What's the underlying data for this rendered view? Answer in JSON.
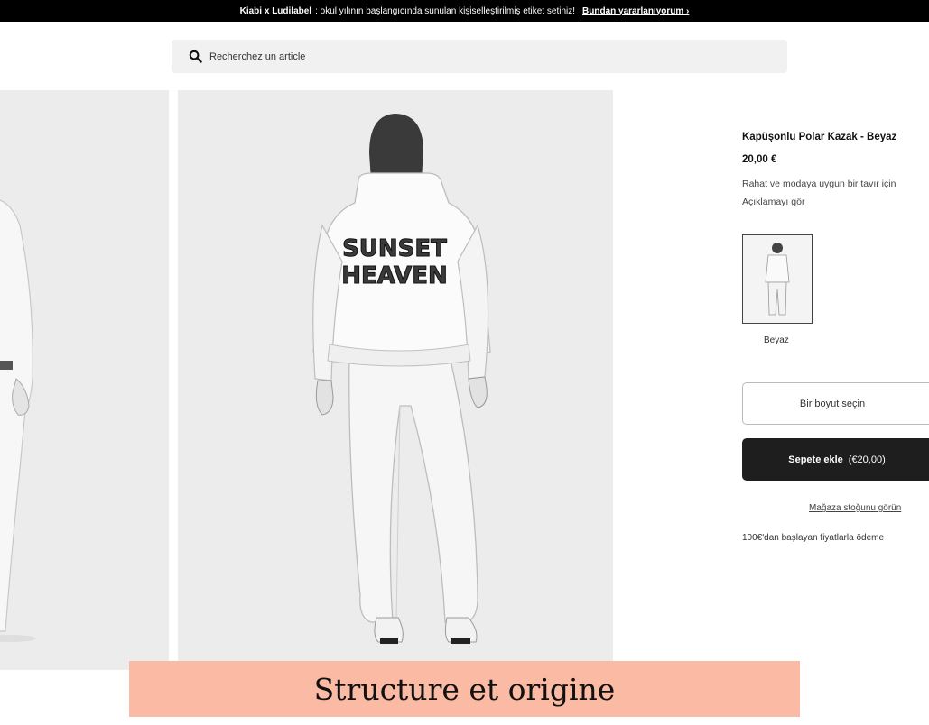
{
  "announcement": {
    "brand": "Kiabi x Ludilabel",
    "text": ": okul yılının başlangıcında sunulan kişiselleştirilmiş etiket setiniz!",
    "link": "Bundan yararlanıyorum ›"
  },
  "search": {
    "placeholder": "Recherchez un article",
    "icon": "search-icon"
  },
  "product": {
    "title": "Kapüşonlu Polar Kazak - Beyaz",
    "price": "20,00 €",
    "description": "Rahat ve modaya uygun bir tavır için",
    "description_link": "Açıklamayı gör",
    "hoodie_print": [
      "SUNSET",
      "HEAVEN"
    ],
    "color_swatch_label": "Beyaz",
    "size_button": "Bir boyut seçin",
    "add_to_cart": "Sepete ekle",
    "add_to_cart_price": "(€20,00)",
    "store_stock_link": "Mağaza stoğunu görün",
    "payment_note": "100€'dan başlayan fiyatlarla ödeme"
  },
  "caption": {
    "text": "Structure et origine",
    "background": "#fbbaa3"
  },
  "colors": {
    "topbar": "#000000",
    "image_bg": "#ececec",
    "cart_button": "#1e1e1e"
  }
}
